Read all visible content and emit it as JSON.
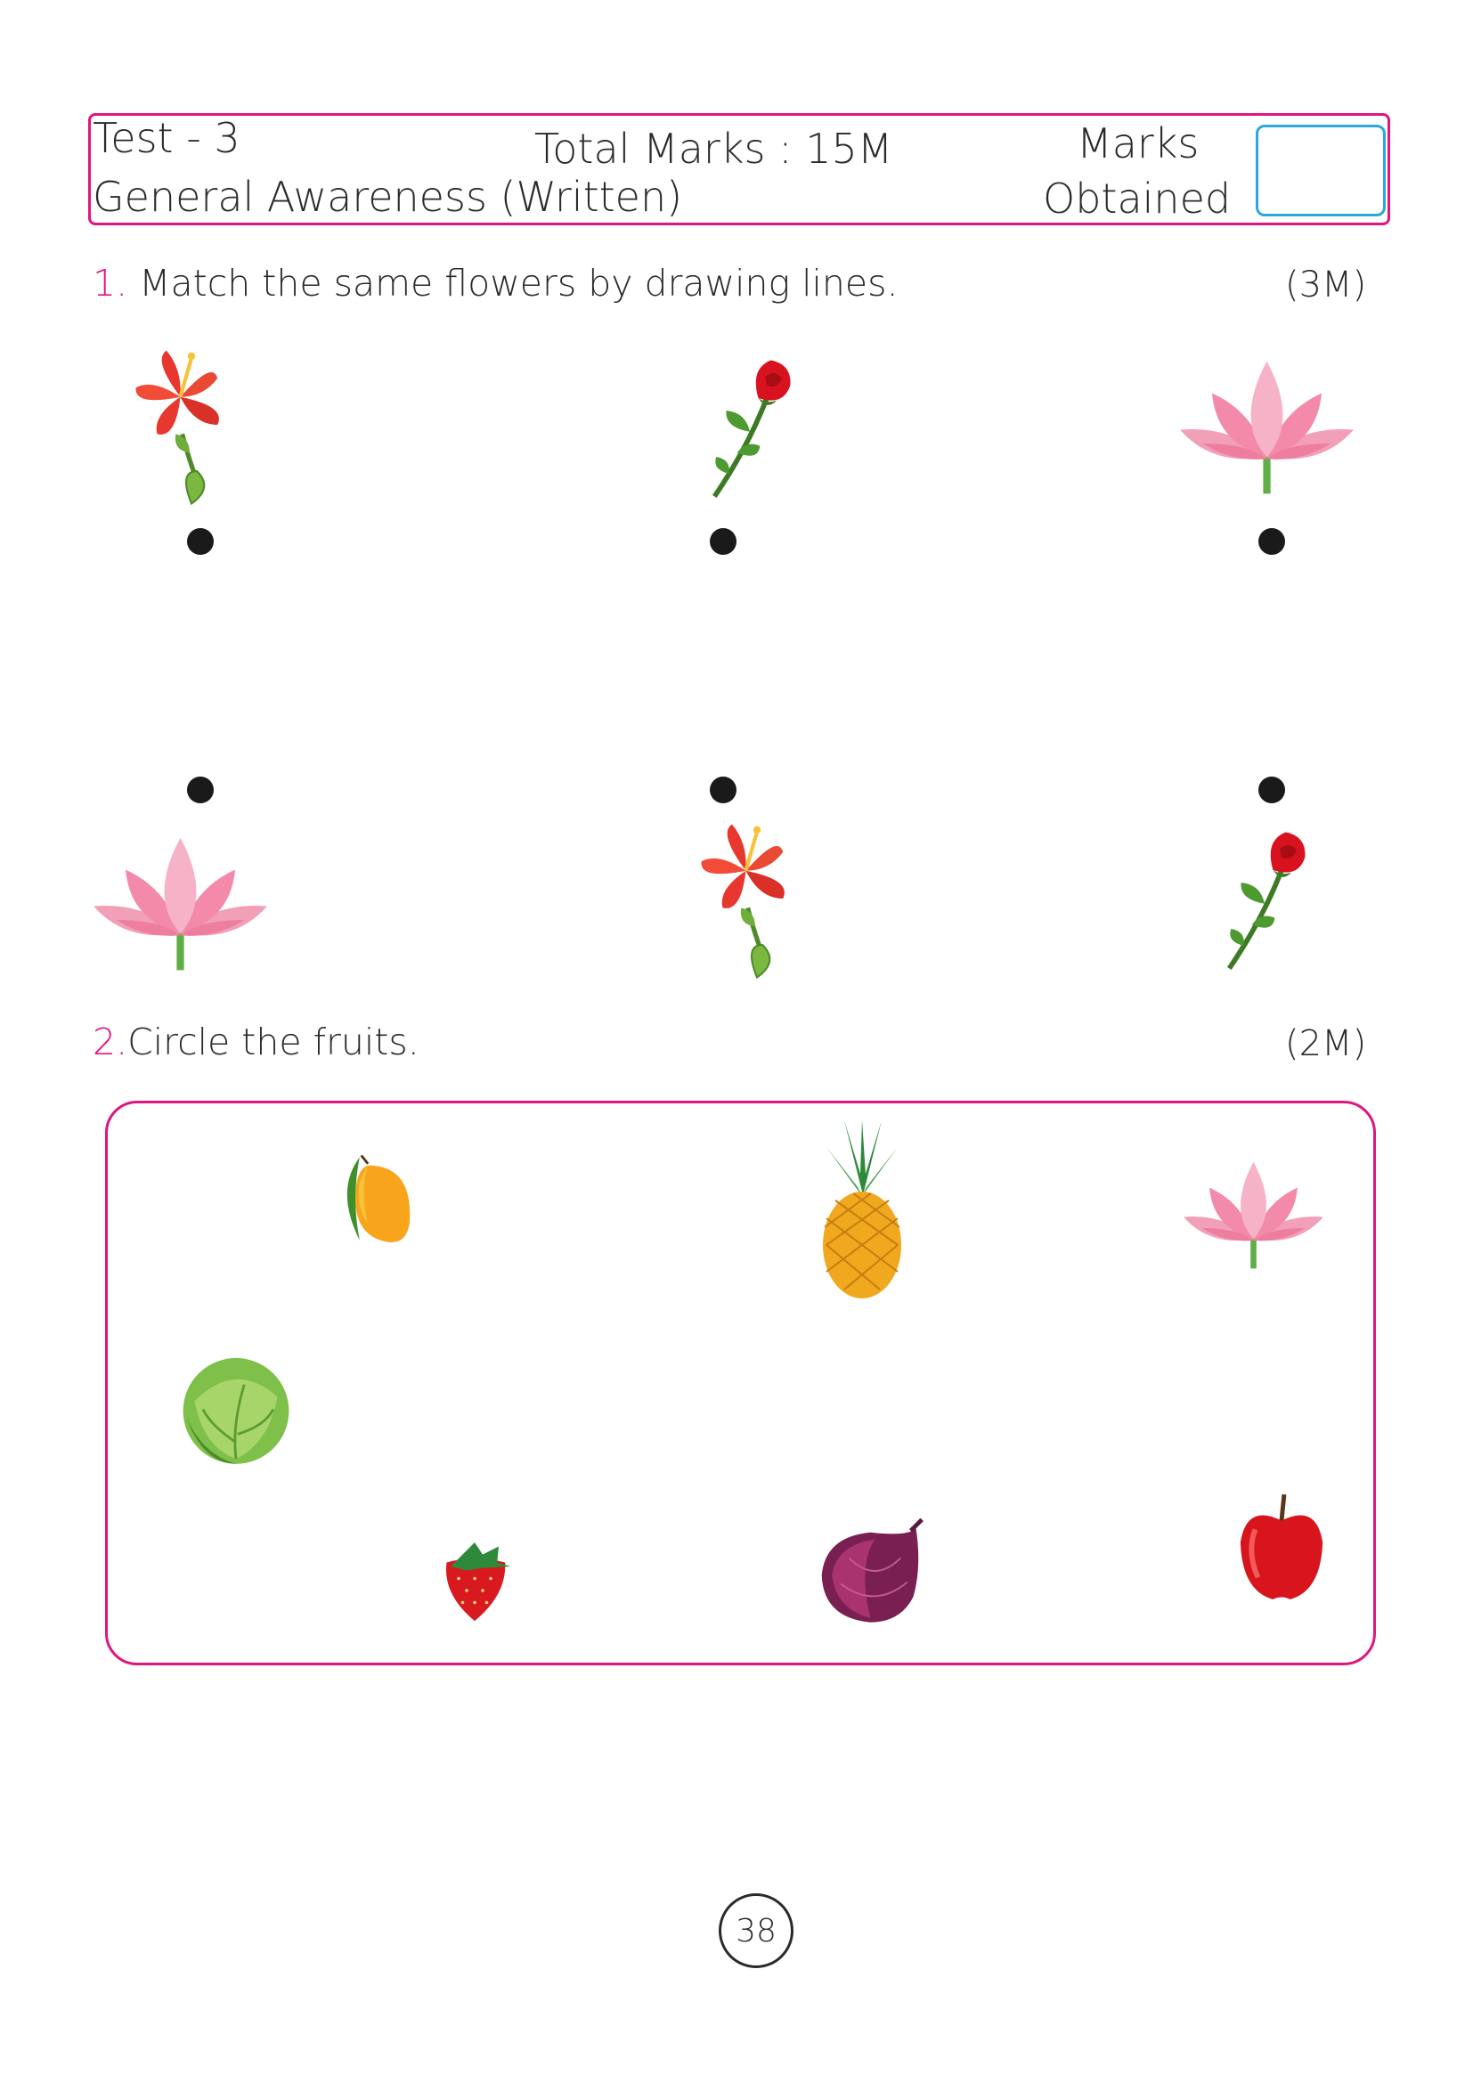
{
  "header": {
    "test": "Test - 3",
    "subject": "General Awareness (Written)",
    "total_marks": "Total Marks : 15M",
    "marks_line1": "Marks",
    "marks_line2": "Obtained"
  },
  "q1": {
    "number": "1.",
    "text": "Match the same flowers by drawing lines.",
    "marks": "(3M)",
    "top_row": [
      "hibiscus-icon",
      "rose-icon",
      "lotus-icon"
    ],
    "bottom_row": [
      "lotus-icon",
      "hibiscus-icon",
      "rose-icon"
    ]
  },
  "q2": {
    "number": "2.",
    "text": "Circle the fruits.",
    "marks": "(2M)",
    "items": [
      "mango-icon",
      "pineapple-icon",
      "lotus-icon",
      "cabbage-icon",
      "strawberry-icon",
      "onion-icon",
      "apple-icon"
    ]
  },
  "colors": {
    "accent": "#e0157f",
    "box_blue": "#29a8e0"
  },
  "page_number": "38"
}
